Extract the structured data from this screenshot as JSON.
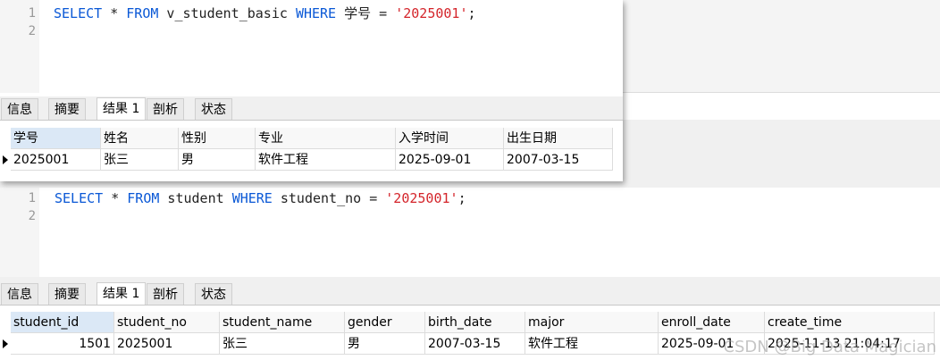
{
  "query1": {
    "line_numbers": [
      "1",
      "2"
    ],
    "sql": {
      "kw_select": "SELECT",
      "star": " * ",
      "kw_from": "FROM",
      "table": " v_student_basic ",
      "kw_where": "WHERE",
      "cond": " 学号 = ",
      "value": "'2025001'",
      "semi": ";"
    },
    "tabs": [
      "信息",
      "摘要",
      "结果 1",
      "剖析",
      "状态"
    ],
    "active_tab": 2,
    "columns": [
      "学号",
      "姓名",
      "性别",
      "专业",
      "入学时间",
      "出生日期"
    ],
    "rows": [
      [
        "2025001",
        "张三",
        "男",
        "软件工程",
        "2025-09-01",
        "2007-03-15"
      ]
    ]
  },
  "query2": {
    "line_numbers": [
      "1",
      "2"
    ],
    "sql": {
      "kw_select": "SELECT",
      "star": " * ",
      "kw_from": "FROM",
      "table": " student ",
      "kw_where": "WHERE",
      "cond": " student_no = ",
      "value": "'2025001'",
      "semi": ";"
    },
    "tabs": [
      "信息",
      "摘要",
      "结果 1",
      "剖析",
      "状态"
    ],
    "active_tab": 2,
    "columns": [
      "student_id",
      "student_no",
      "student_name",
      "gender",
      "birth_date",
      "major",
      "enroll_date",
      "create_time"
    ],
    "rows": [
      [
        "1501",
        "2025001",
        "张三",
        "男",
        "2007-03-15",
        "软件工程",
        "2025-09-01",
        "2025-11-13 21:04:17"
      ]
    ]
  },
  "watermark": "CSDN @Big Data Magician",
  "colors": {
    "keyword": "#0a58d6",
    "string": "#d4242a",
    "header_selected": "#dbe8f6"
  }
}
